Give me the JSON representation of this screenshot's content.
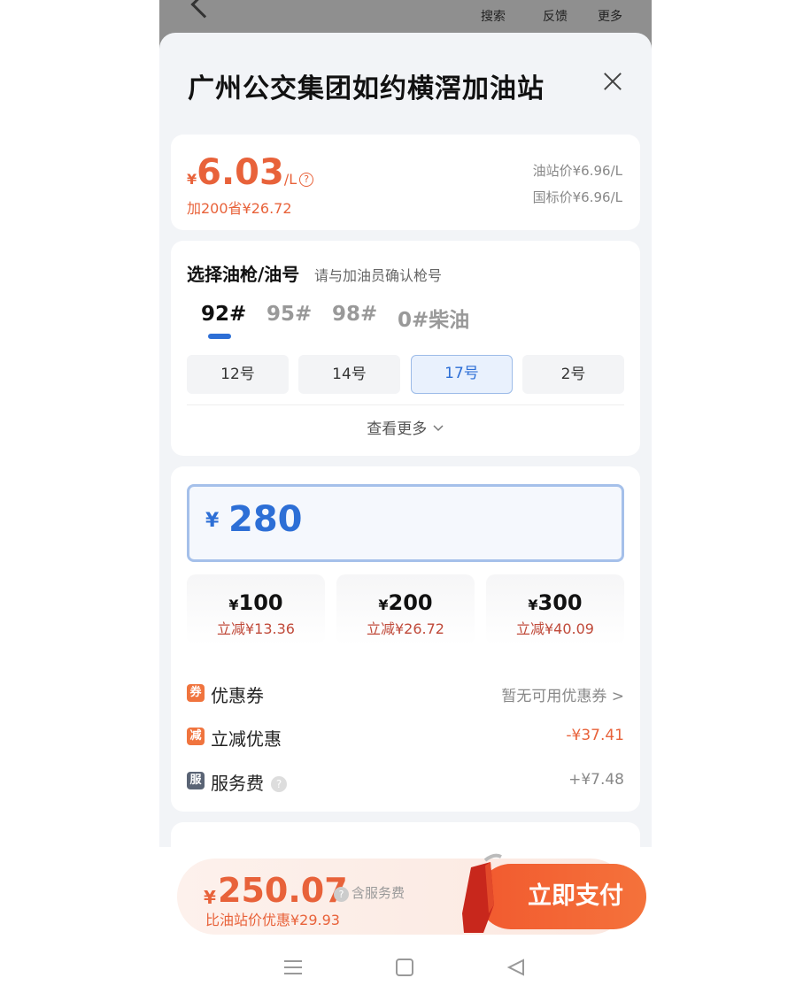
{
  "topbar": {
    "search": "搜索",
    "feedback": "反馈",
    "more": "更多"
  },
  "station": {
    "name": "广州公交集团如约横滘加油站"
  },
  "price": {
    "currency": "¥",
    "value": "6.03",
    "unit": "/L",
    "help": "?",
    "saving": "加200省¥26.72",
    "station_price": "油站价¥6.96/L",
    "national_price": "国标价¥6.96/L"
  },
  "gun": {
    "title": "选择油枪/油号",
    "hint": "请与加油员确认枪号",
    "fuel_tabs": [
      "92#",
      "95#",
      "98#",
      "0#柴油"
    ],
    "active_tab": "92#",
    "guns": [
      "12号",
      "14号",
      "17号",
      "2号"
    ],
    "active_gun": "17号",
    "more": "查看更多"
  },
  "amount": {
    "currency": "¥",
    "value": "280",
    "presets": [
      {
        "value": "100",
        "discount": "立减¥13.36"
      },
      {
        "value": "200",
        "discount": "立减¥26.72"
      },
      {
        "value": "300",
        "discount": "立减¥40.09"
      }
    ]
  },
  "rows": {
    "coupon": {
      "badge": "券",
      "label": "优惠券",
      "value": "暂无可用优惠券 >"
    },
    "discount": {
      "badge": "减",
      "label": "立减优惠",
      "value": "-¥37.41"
    },
    "service": {
      "badge": "服",
      "label": "服务费",
      "value": "+¥7.48"
    }
  },
  "pay": {
    "currency": "¥",
    "total": "250.07",
    "note": "含服务费",
    "discount": "比油站价优惠¥29.93",
    "button": "立即支付"
  },
  "colors": {
    "accent": "#e8623a",
    "blue": "#2d6fd6",
    "pay_button": "#f25a2f"
  }
}
